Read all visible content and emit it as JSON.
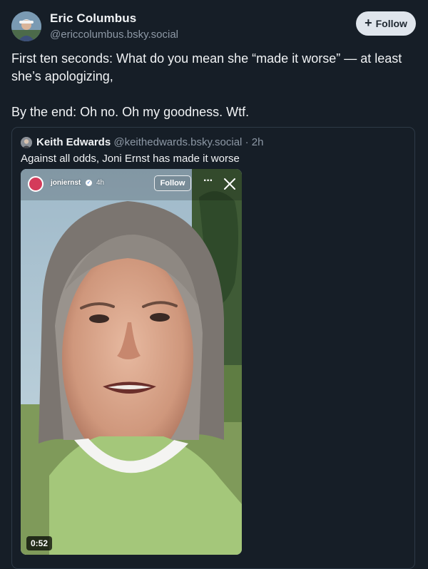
{
  "post": {
    "author_name": "Eric Columbus",
    "author_handle": "@ericcolumbus.bsky.social",
    "follow_label": "Follow",
    "text": "First ten seconds: What do you mean she “made it worse” — at least she’s apologizing,\n\nBy the end: Oh no. Oh my goodness. Wtf."
  },
  "quote": {
    "author_name": "Keith Edwards",
    "author_handle": "@keithedwards.bsky.social",
    "separator": "·",
    "time": "2h",
    "text": "Against all odds, Joni Ernst has made it worse",
    "video": {
      "ig_username": "joniernst",
      "ig_time": "4h",
      "ig_follow_label": "Follow",
      "ig_more": "···",
      "duration": "0:52"
    }
  },
  "icons": {
    "follow": "plus-icon",
    "close": "close-icon",
    "verified": "verified-badge-icon",
    "more": "more-horizontal-icon"
  },
  "colors": {
    "background": "#161e27",
    "text": "#f1f3f5",
    "muted": "#8d98a5",
    "follow_button": "#dfe5ec",
    "quote_border": "#2e3a47"
  }
}
